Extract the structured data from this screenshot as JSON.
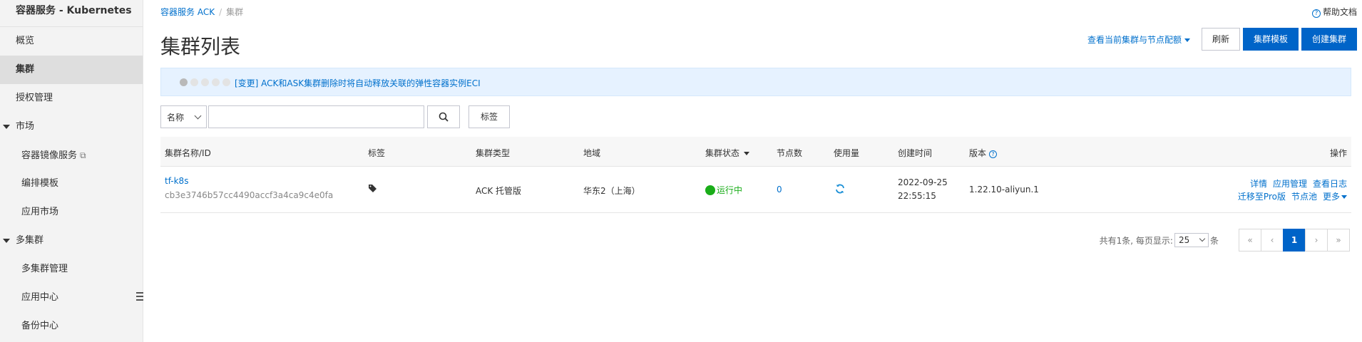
{
  "sidebar": {
    "title": "容器服务 - Kubernetes",
    "items": [
      {
        "label": "概览"
      },
      {
        "label": "集群"
      },
      {
        "label": "授权管理"
      }
    ],
    "market": {
      "label": "市场",
      "items": [
        {
          "label": "容器镜像服务"
        },
        {
          "label": "编排模板"
        },
        {
          "label": "应用市场"
        }
      ]
    },
    "multi_cluster": {
      "label": "多集群",
      "items": [
        {
          "label": "多集群管理"
        },
        {
          "label": "应用中心"
        },
        {
          "label": "备份中心"
        }
      ]
    }
  },
  "breadcrumb": {
    "root": "容器服务 ACK",
    "separator": "/",
    "current": "集群"
  },
  "help": {
    "label": "帮助文档"
  },
  "page": {
    "title": "集群列表"
  },
  "toolbar": {
    "quota_link": "查看当前集群与节点配额",
    "refresh": "刷新",
    "template": "集群模板",
    "create": "创建集群"
  },
  "notice": {
    "text": "[变更] ACK和ASK集群删除时将自动释放关联的弹性容器实例ECI",
    "active_dot": 1,
    "dot_count": 5
  },
  "search": {
    "field": "名称",
    "value": "",
    "tag_button": "标签"
  },
  "table": {
    "headers": {
      "name": "集群名称/ID",
      "tags": "标签",
      "type": "集群类型",
      "region": "地域",
      "status": "集群状态",
      "nodes": "节点数",
      "usage": "使用量",
      "created": "创建时间",
      "version": "版本",
      "ops": "操作"
    },
    "rows": [
      {
        "name": "tf-k8s",
        "id": "cb3e3746b57cc4490accf3a4ca9c4e0fa",
        "type": "ACK 托管版",
        "region": "华东2（上海）",
        "status": "运行中",
        "nodes": "0",
        "created_date": "2022-09-25",
        "created_time": "22:55:15",
        "version": "1.22.10-aliyun.1",
        "ops": {
          "detail": "详情",
          "app": "应用管理",
          "logs": "查看日志",
          "migrate": "迁移至Pro版",
          "nodepool": "节点池",
          "more": "更多"
        }
      }
    ]
  },
  "pagination": {
    "total_text": "共有1条, 每页显示:",
    "page_size": "25",
    "unit": "条",
    "first": "«",
    "prev": "‹",
    "current": "1",
    "next": "›",
    "last": "»"
  },
  "colors": {
    "primary": "#0064c8",
    "link": "#0070cc",
    "success": "#1aad19",
    "notice_bg": "#e6f2ff"
  }
}
